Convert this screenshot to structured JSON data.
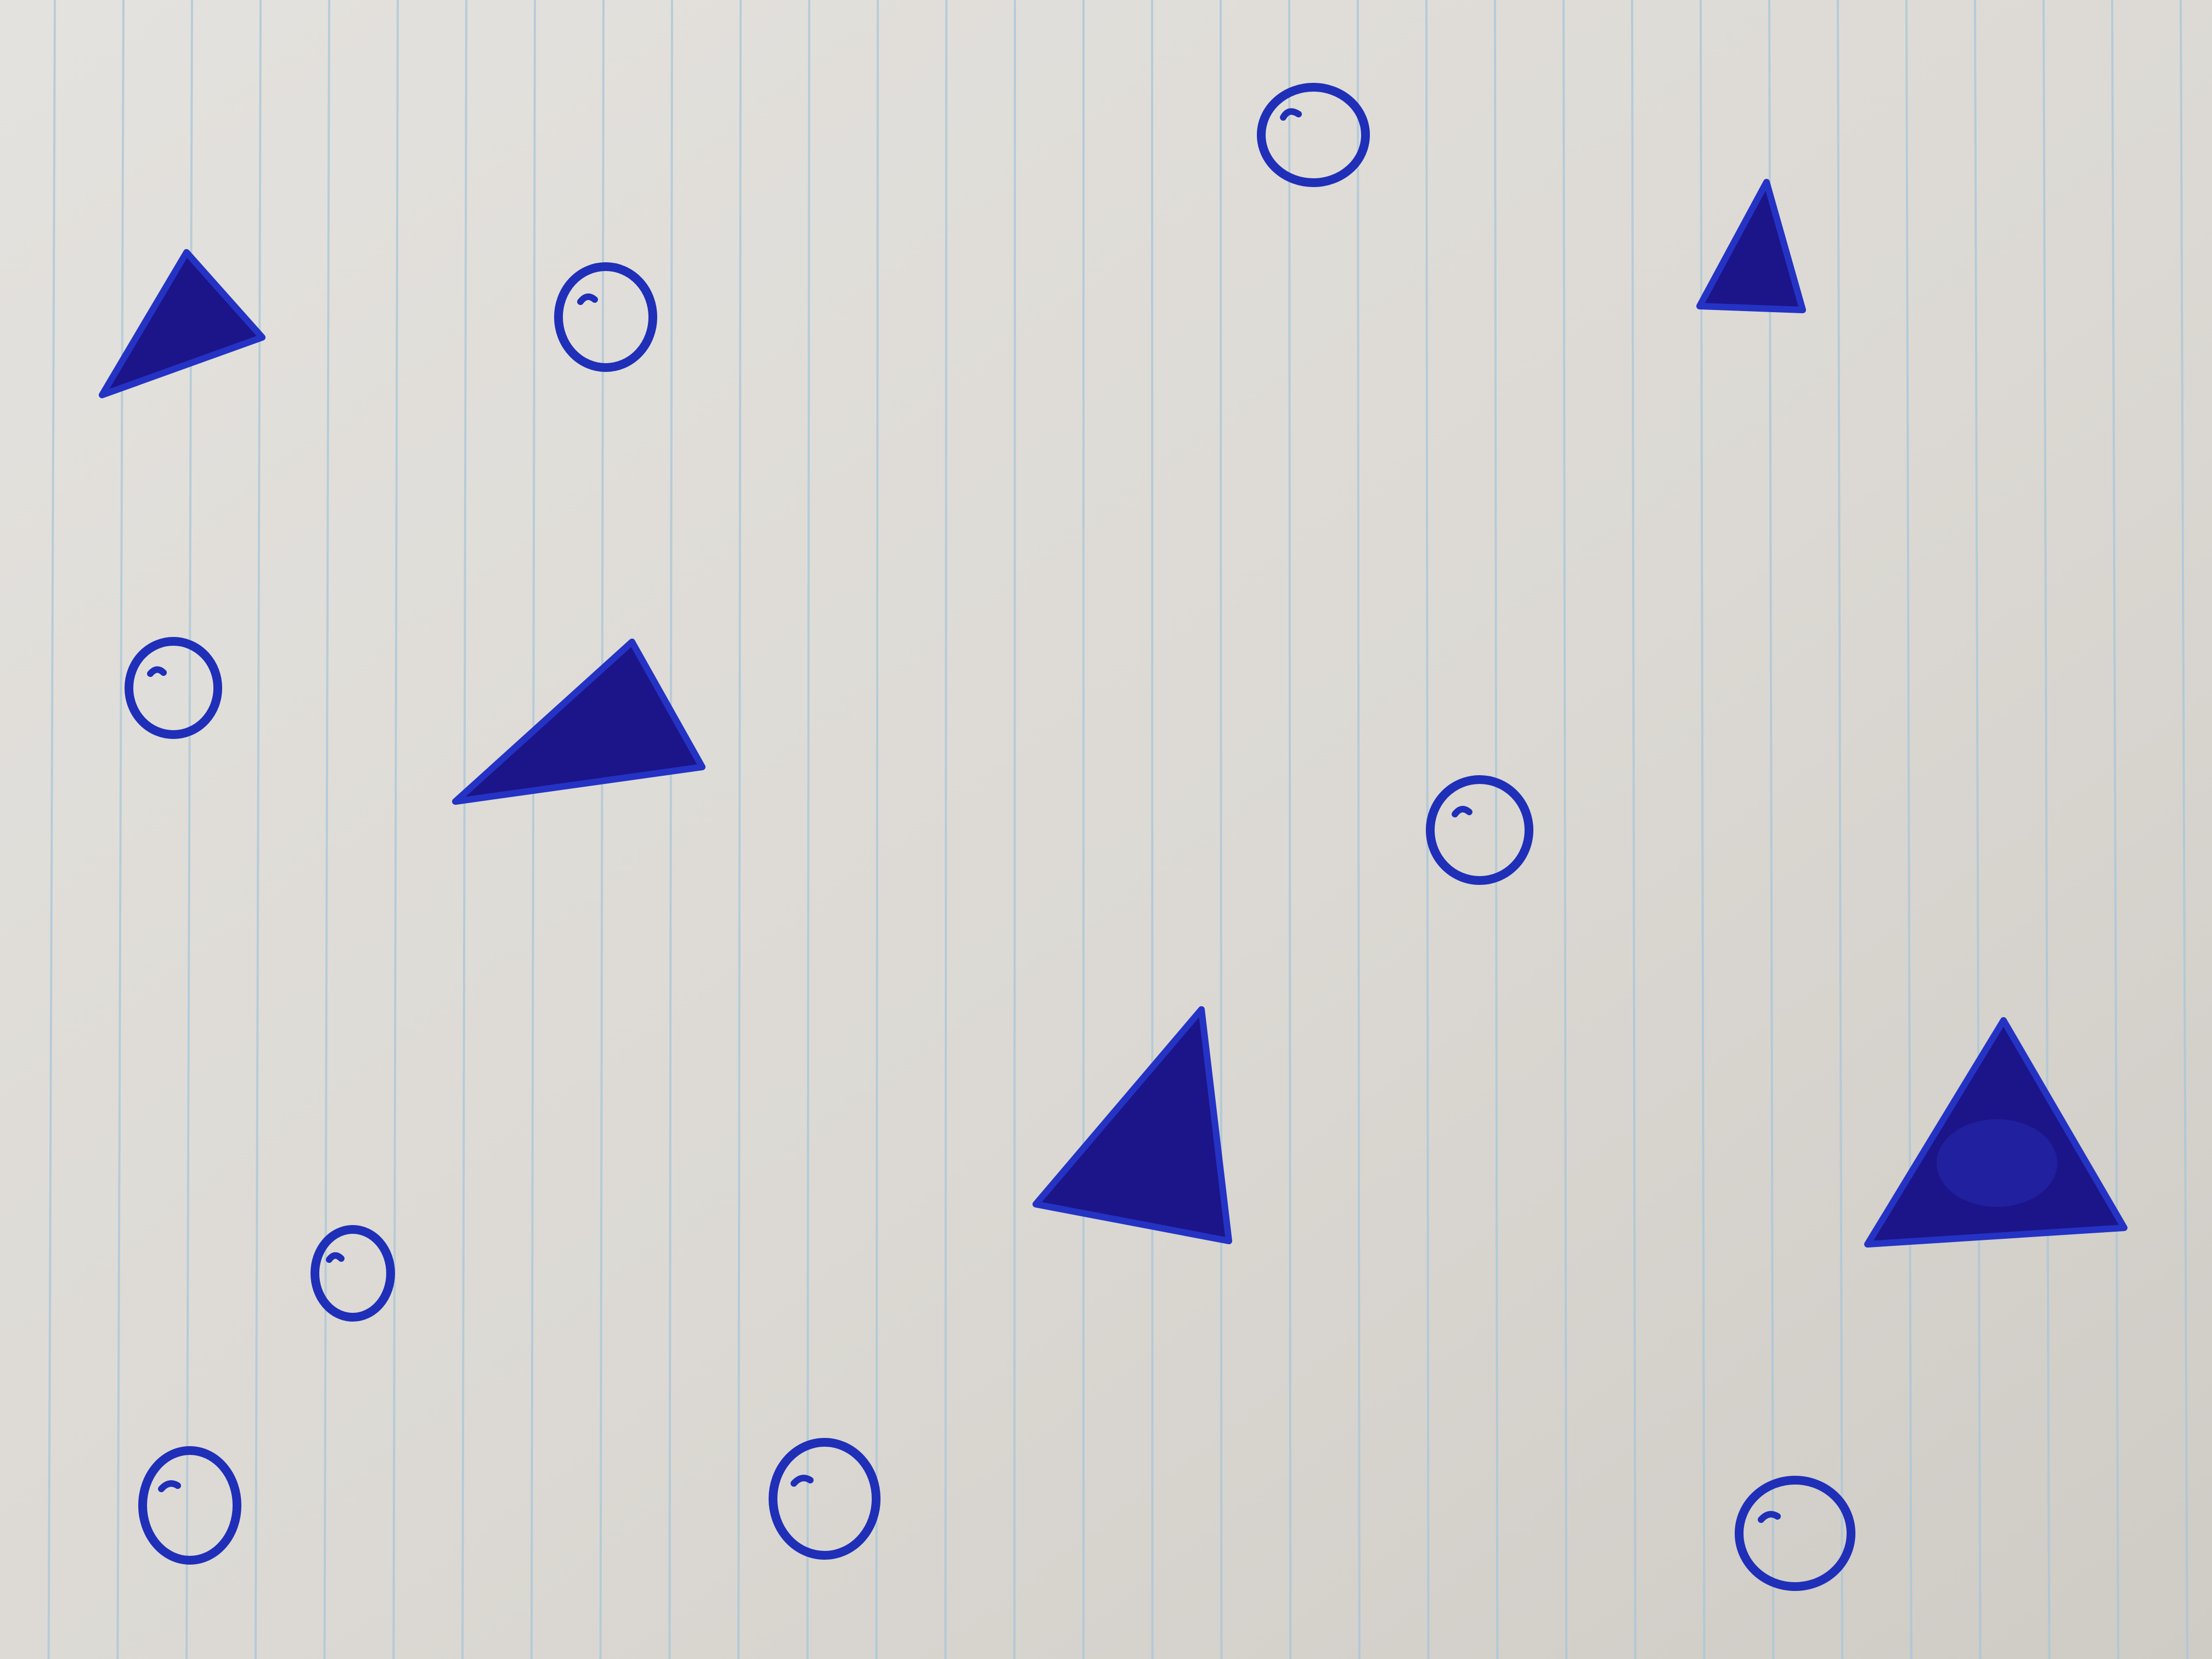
{
  "photo": {
    "paper_color": "#dedbd6",
    "rule_color": "#a9c6d8",
    "ink_color": "#1f2fb8",
    "fill_color": "#1c1489",
    "shapes": [
      {
        "kind": "circle"
      },
      {
        "kind": "circle"
      },
      {
        "kind": "circle"
      },
      {
        "kind": "circle"
      },
      {
        "kind": "circle"
      },
      {
        "kind": "circle"
      },
      {
        "kind": "circle"
      },
      {
        "kind": "triangle"
      },
      {
        "kind": "triangle"
      },
      {
        "kind": "triangle"
      },
      {
        "kind": "triangle"
      },
      {
        "kind": "triangle"
      }
    ]
  }
}
